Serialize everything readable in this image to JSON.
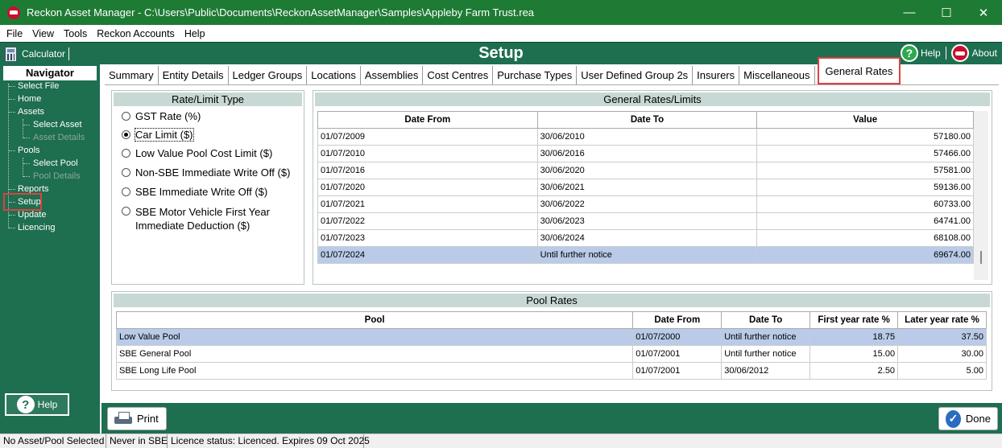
{
  "window": {
    "title": "Reckon Asset Manager - C:\\Users\\Public\\Documents\\ReckonAssetManager\\Samples\\Appleby Farm Trust.rea",
    "controls": {
      "minimize": "—",
      "maximize": "☐",
      "close": "✕"
    }
  },
  "menu": [
    "File",
    "View",
    "Tools",
    "Reckon Accounts",
    "Help"
  ],
  "header": {
    "calculator_label": "Calculator",
    "title": "Setup",
    "help_label": "Help",
    "about_label": "About",
    "help_glyph": "?"
  },
  "navigator": {
    "title": "Navigator",
    "items": {
      "select_file": "Select File",
      "home": "Home",
      "assets": "Assets",
      "select_asset": "Select Asset",
      "asset_details": "Asset Details",
      "pools": "Pools",
      "select_pool": "Select Pool",
      "pool_details": "Pool Details",
      "reports": "Reports",
      "setup": "Setup",
      "update": "Update",
      "licencing": "Licencing"
    },
    "help_label": "Help",
    "help_glyph": "?"
  },
  "tabs": [
    "Summary",
    "Entity Details",
    "Ledger Groups",
    "Locations",
    "Assemblies",
    "Cost Centres",
    "Purchase Types",
    "User Defined Group 2s",
    "Insurers",
    "Miscellaneous",
    "General Rates"
  ],
  "rate_type_panel": {
    "title": "Rate/Limit Type",
    "options": [
      "GST Rate (%)",
      "Car Limit ($)",
      "Low Value Pool Cost Limit ($)",
      "Non-SBE Immediate Write Off ($)",
      "SBE Immediate Write Off ($)",
      "SBE Motor Vehicle First Year",
      "Immediate Deduction ($)"
    ],
    "selected_index": 1
  },
  "general_rates": {
    "title": "General Rates/Limits",
    "columns": [
      "Date From",
      "Date To",
      "Value"
    ],
    "rows": [
      [
        "01/07/2009",
        "30/06/2010",
        "57180.00"
      ],
      [
        "01/07/2010",
        "30/06/2016",
        "57466.00"
      ],
      [
        "01/07/2016",
        "30/06/2020",
        "57581.00"
      ],
      [
        "01/07/2020",
        "30/06/2021",
        "59136.00"
      ],
      [
        "01/07/2021",
        "30/06/2022",
        "60733.00"
      ],
      [
        "01/07/2022",
        "30/06/2023",
        "64741.00"
      ],
      [
        "01/07/2023",
        "30/06/2024",
        "68108.00"
      ],
      [
        "01/07/2024",
        "Until further notice",
        "69674.00"
      ]
    ],
    "selected_row": 7
  },
  "pool_rates": {
    "title": "Pool Rates",
    "columns": [
      "Pool",
      "Date From",
      "Date To",
      "First year rate %",
      "Later year rate %"
    ],
    "rows": [
      [
        "Low Value Pool",
        "01/07/2000",
        "Until further notice",
        "18.75",
        "37.50"
      ],
      [
        "SBE General Pool",
        "01/07/2001",
        "Until further notice",
        "15.00",
        "30.00"
      ],
      [
        "SBE Long Life Pool",
        "01/07/2001",
        "30/06/2012",
        "2.50",
        "5.00"
      ]
    ],
    "selected_row": 0
  },
  "footer": {
    "print_label": "Print",
    "done_label": "Done",
    "done_glyph": "✓"
  },
  "statusbar": [
    "No Asset/Pool Selected",
    "Never in SBE",
    "Licence status: Licenced. Expires 09 Oct 2025"
  ],
  "colors": {
    "titlebar": "#1e7b34",
    "app_green": "#1e6e50",
    "highlight_red": "#e04040",
    "selected_row": "#b9cbe8"
  }
}
